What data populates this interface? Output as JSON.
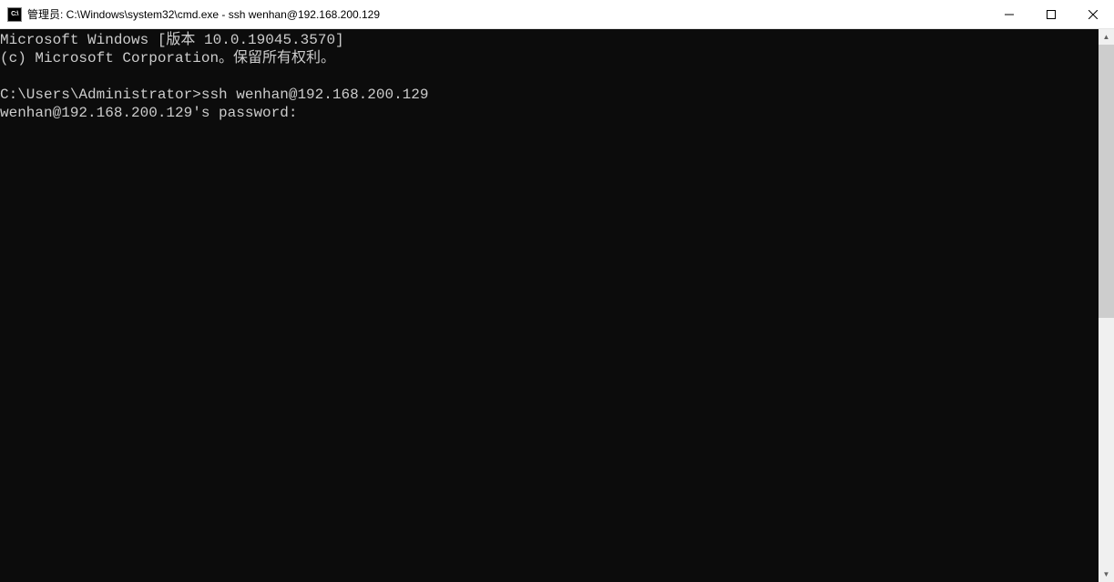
{
  "window": {
    "icon_label": "C:\\",
    "title": "管理员: C:\\Windows\\system32\\cmd.exe - ssh  wenhan@192.168.200.129"
  },
  "terminal": {
    "line1": "Microsoft Windows [版本 10.0.19045.3570]",
    "line2": "(c) Microsoft Corporation。保留所有权利。",
    "blank1": "",
    "prompt_line": "C:\\Users\\Administrator>ssh wenhan@192.168.200.129",
    "password_line": "wenhan@192.168.200.129's password:"
  }
}
